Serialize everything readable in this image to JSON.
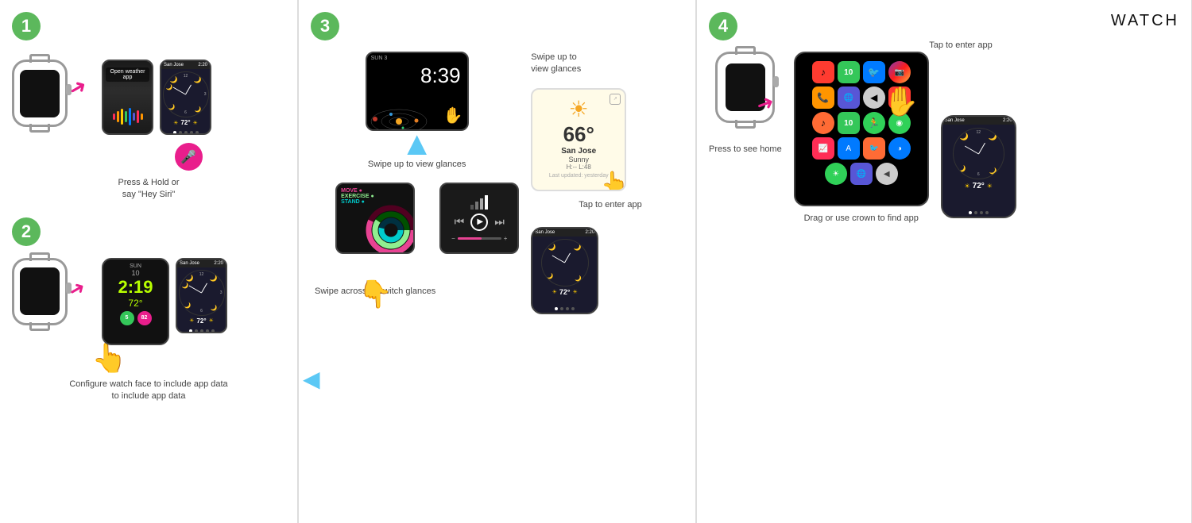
{
  "steps": [
    {
      "number": "1",
      "caption1": "Press & Hold or",
      "caption2": "say \"Hey Siri\"",
      "siri_text": "Open weather app",
      "screens": {
        "siri_colors": [
          "#ff2d55",
          "#ff9500",
          "#ffcc00",
          "#34c759",
          "#007aff",
          "#5856d6"
        ],
        "weather_header": "San Jose",
        "weather_time": "2:20",
        "weather_temp": "72°"
      }
    },
    {
      "number": "2",
      "caption": "Configure watch face\nto include app data",
      "screens": {
        "day": "SUN",
        "date": "10",
        "time": "2:19",
        "temp": "72°",
        "badge1": "5",
        "badge2": "82",
        "badge1_color": "#34c759",
        "badge2_color": "#e91e8c",
        "weather_header": "San Jose",
        "weather_time": "2:20",
        "weather_temp": "72°"
      }
    },
    {
      "number": "3",
      "swipe_up_caption": "Swipe up to\nview glances",
      "swipe_across_caption": "Swipe across to\nswitch glances",
      "tap_caption": "Tap to\nenter app",
      "screens": {
        "time": "8:39",
        "date": "SUN 3",
        "weather_temp": "66°",
        "weather_city": "San Jose",
        "weather_condition": "Sunny",
        "weather_hl": "H:-- L:48",
        "weather_updated": "Last updated: yesterday"
      }
    },
    {
      "number": "4",
      "press_caption": "Press to see\nhome",
      "drag_caption": "Drag or use\ncrown to find app",
      "tap_caption": "Tap to\nenter app",
      "brand_text": "WATCH",
      "screens": {
        "weather_header": "San Jose",
        "weather_time": "2:20",
        "weather_temp": "72°"
      }
    }
  ]
}
